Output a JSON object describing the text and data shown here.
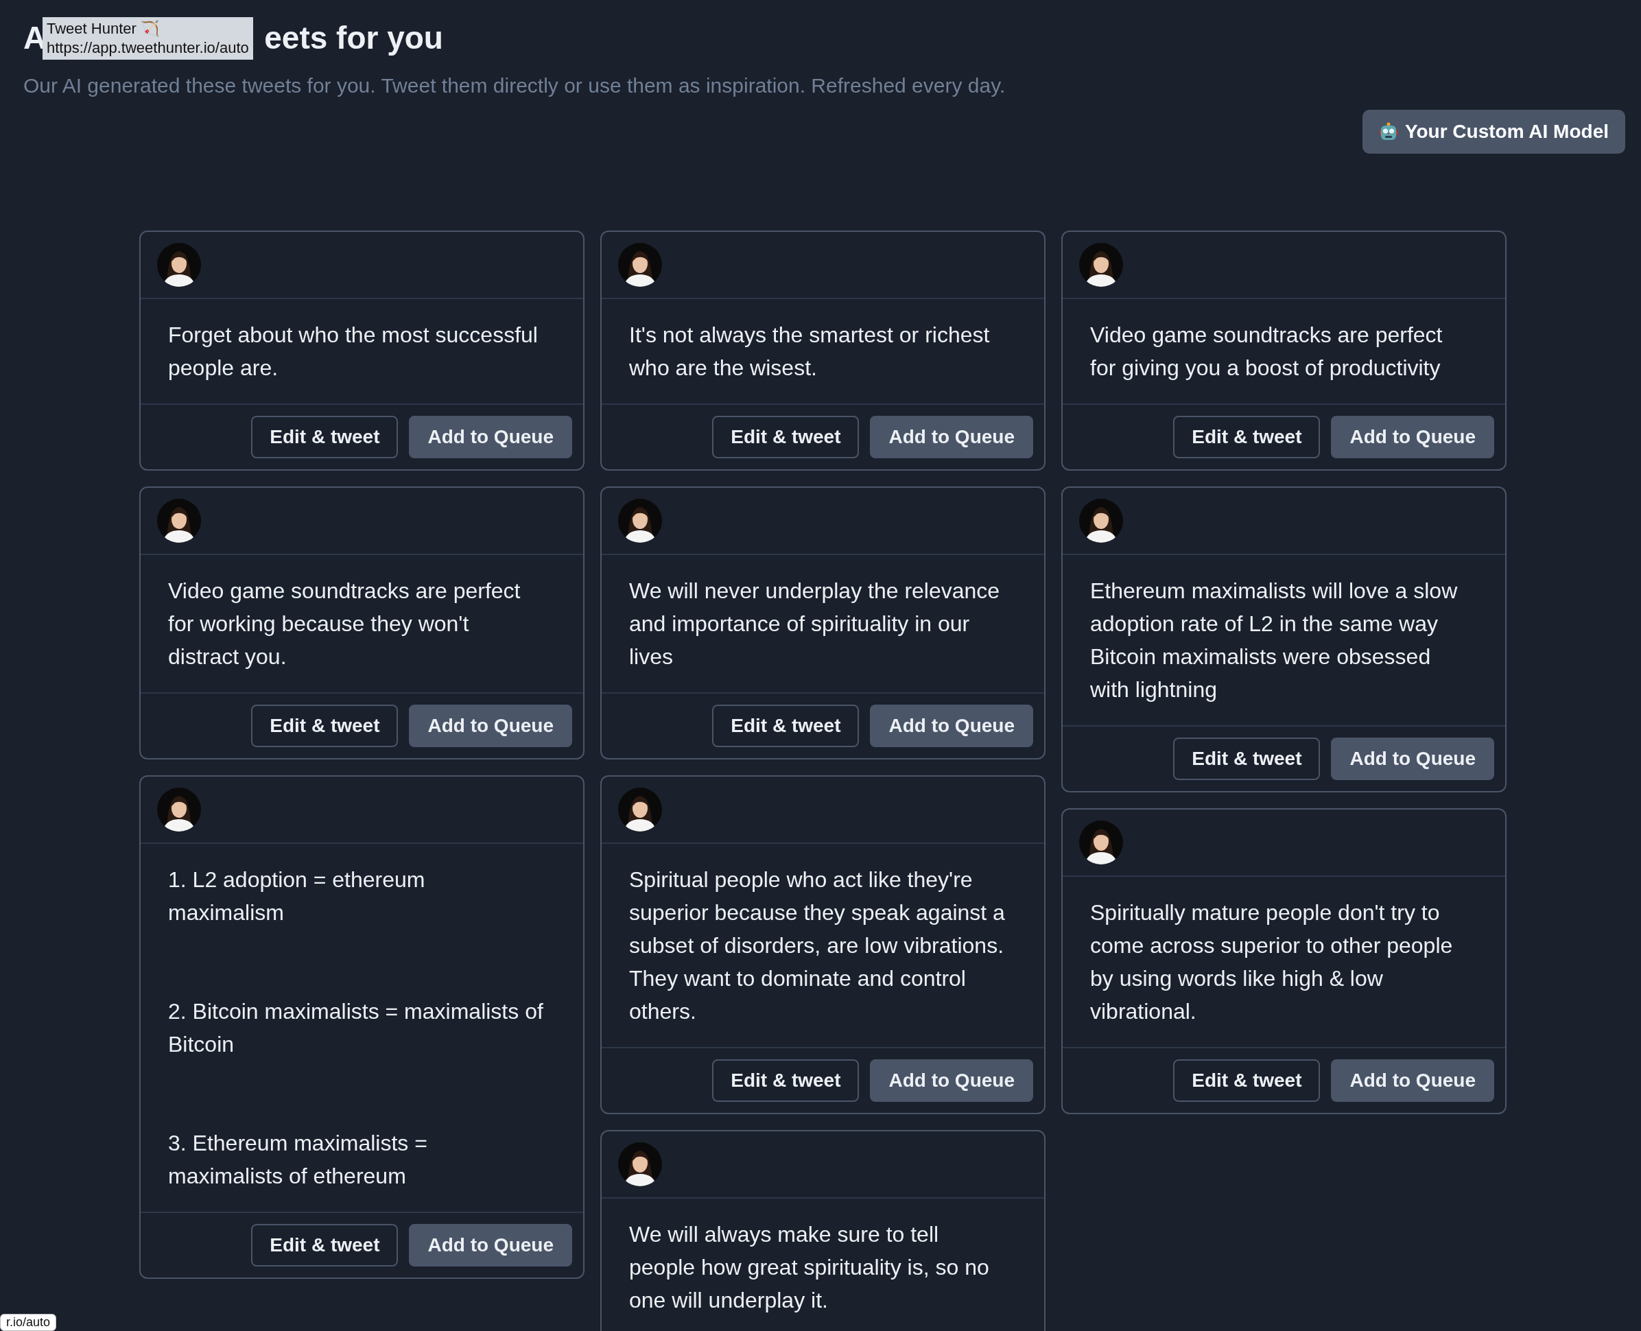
{
  "heading": {
    "start": "A",
    "end": "eets for you"
  },
  "tooltip": {
    "title": "Tweet Hunter 🏹",
    "url": "https://app.tweethunter.io/auto"
  },
  "subtitle": "Our AI generated these tweets for you. Tweet them directly or use them as inspiration. Refreshed every day.",
  "custom_model_button": {
    "label": "Your Custom AI Model"
  },
  "columns": [
    {
      "cards": [
        {
          "text": "Forget about who the most successful people are.",
          "buttons": [
            "Edit & tweet",
            "Add to Queue"
          ]
        },
        {
          "text": "Video game soundtracks are perfect for working because they won't distract you.",
          "buttons": [
            "Edit & tweet",
            "Add to Queue"
          ]
        },
        {
          "text": "1. L2 adoption = ethereum maximalism\n\n\n2. Bitcoin maximalists = maximalists of Bitcoin\n\n\n3. Ethereum maximalists = maximalists of ethereum",
          "buttons": [
            "Edit & tweet",
            "Add to Queue"
          ]
        }
      ]
    },
    {
      "cards": [
        {
          "text": "It's not always the smartest or richest who are the wisest.",
          "buttons": [
            "Edit & tweet",
            "Add to Queue"
          ]
        },
        {
          "text": "We will never underplay the relevance and importance of spirituality in our lives",
          "buttons": [
            "Edit & tweet",
            "Add to Queue"
          ]
        },
        {
          "text": "Spiritual people who act like they're superior because they speak against a subset of disorders, are low vibrations. They want to dominate and control others.",
          "buttons": [
            "Edit & tweet",
            "Add to Queue"
          ]
        },
        {
          "text": "We will always make sure to tell people how great spirituality is, so no one will underplay it."
        }
      ]
    },
    {
      "cards": [
        {
          "text": "Video game soundtracks are perfect for giving you a boost of productivity",
          "buttons": [
            "Edit & tweet",
            "Add to Queue"
          ]
        },
        {
          "text": "Ethereum maximalists will love a slow adoption rate of L2 in the same way Bitcoin maximalists were obsessed with lightning",
          "buttons": [
            "Edit & tweet",
            "Add to Queue"
          ]
        },
        {
          "text": "Spiritually mature people don't try to come across superior to other people by using words like high & low vibrational.",
          "buttons": [
            "Edit & tweet",
            "Add to Queue"
          ]
        }
      ]
    }
  ],
  "status_url": "r.io/auto"
}
